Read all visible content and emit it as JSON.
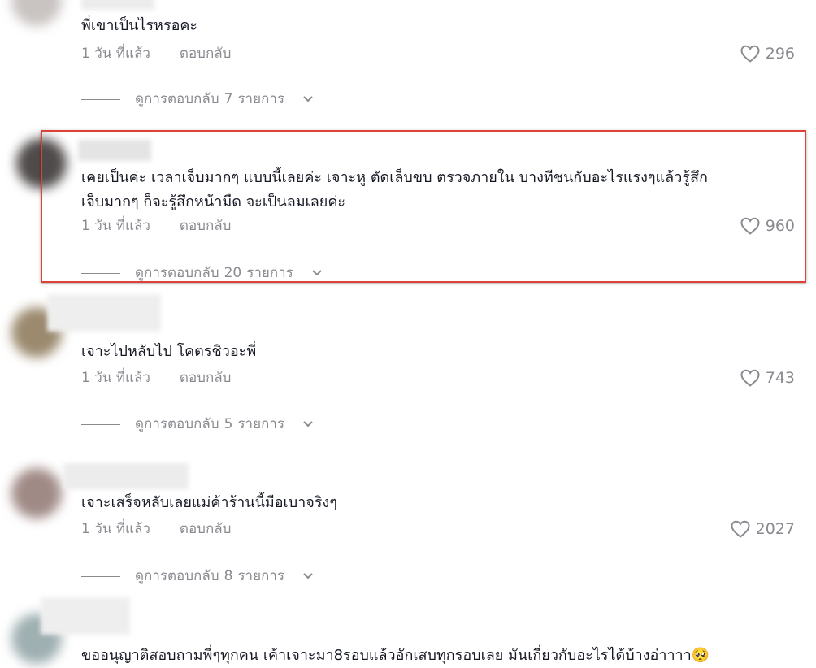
{
  "comments": [
    {
      "text": "พี่เขาเป็นไรหรอคะ",
      "time": "1 วัน ที่แล้ว",
      "reply": "ตอบกลับ",
      "likes": "296",
      "view_replies_prefix": "ดูการตอบกลับ",
      "view_replies_count": "7",
      "view_replies_suffix": "รายการ"
    },
    {
      "text_line1": "เคยเป็นค่ะ เวลาเจ็บมากๆ แบบนี้เลยค่ะ เจาะหู ตัดเล็บขบ ตรวจภายใน บางทีชนกับอะไรแรงๆแล้วรู้สึก",
      "text_line2": "เจ็บมากๆ ก็จะรู้สึกหน้ามืด จะเป็นลมเลยค่ะ",
      "time": "1 วัน ที่แล้ว",
      "reply": "ตอบกลับ",
      "likes": "960",
      "view_replies_prefix": "ดูการตอบกลับ",
      "view_replies_count": "20",
      "view_replies_suffix": "รายการ"
    },
    {
      "text": "เจาะไปหลับไป โคตรชิวอะพี่",
      "time": "1 วัน ที่แล้ว",
      "reply": "ตอบกลับ",
      "likes": "743",
      "view_replies_prefix": "ดูการตอบกลับ",
      "view_replies_count": "5",
      "view_replies_suffix": "รายการ"
    },
    {
      "text": "เจาะเสร็จหลับเลยแม่ค้าร้านนี้มือเบาจริงๆ",
      "time": "1 วัน ที่แล้ว",
      "reply": "ตอบกลับ",
      "likes": "2027",
      "view_replies_prefix": "ดูการตอบกลับ",
      "view_replies_count": "8",
      "view_replies_suffix": "รายการ"
    },
    {
      "text": "ขออนุญาติสอบถามพี่ๆทุกคน เค้าเจาะมา8รอบแล้วอักเสบทุกรอบเลย มันเกี่ยวกับอะไรได้บ้างอ่าาาา",
      "emoji": "🥺"
    }
  ],
  "colors": {
    "highlight_border": "#e0403a",
    "text_primary": "#161823",
    "text_secondary": "#8a8b91"
  },
  "icons": {
    "like": "heart-outline-icon",
    "expand": "chevron-down-icon"
  }
}
